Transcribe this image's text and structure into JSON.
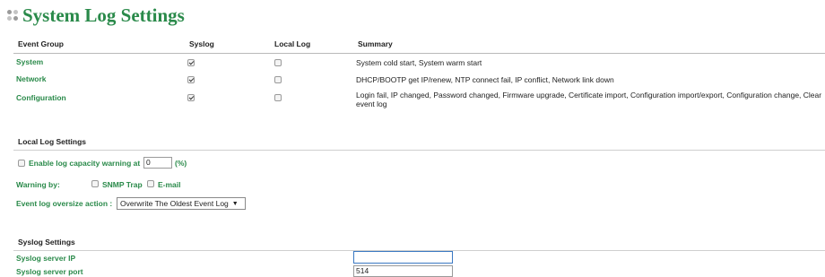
{
  "page": {
    "title": "System Log Settings"
  },
  "table": {
    "headers": {
      "group": "Event Group",
      "syslog": "Syslog",
      "local_log": "Local Log",
      "summary": "Summary"
    },
    "rows": [
      {
        "group": "System",
        "syslog": true,
        "local_log": false,
        "summary": "System cold start, System warm start"
      },
      {
        "group": "Network",
        "syslog": true,
        "local_log": false,
        "summary": "DHCP/BOOTP get IP/renew, NTP connect fail, IP conflict, Network link down"
      },
      {
        "group": "Configuration",
        "syslog": true,
        "local_log": false,
        "summary": "Login fail, IP changed, Password changed, Firmware upgrade, Certificate import, Configuration import/export, Configuration change, Clear event log"
      }
    ]
  },
  "local_log": {
    "title": "Local Log Settings",
    "capacity_label": "Enable log capacity warning at",
    "capacity_value": "0",
    "capacity_unit": "(%)",
    "capacity_checked": false,
    "warning_by_label": "Warning by:",
    "snmp_label": "SNMP Trap",
    "snmp_checked": false,
    "email_label": "E-mail",
    "email_checked": false,
    "oversize_label": "Event log oversize action :",
    "oversize_value": "Overwrite The Oldest Event Log"
  },
  "syslog": {
    "title": "Syslog Settings",
    "server_ip_label": "Syslog server IP",
    "server_ip_value": "",
    "server_port_label": "Syslog server port",
    "server_port_value": "514"
  },
  "colors": {
    "accent": "#2a8a4a",
    "border": "#b9b9b9"
  },
  "icons": {
    "title": "dots-icon",
    "dropdown": "chevron-down-icon",
    "check": "checkmark-icon"
  }
}
